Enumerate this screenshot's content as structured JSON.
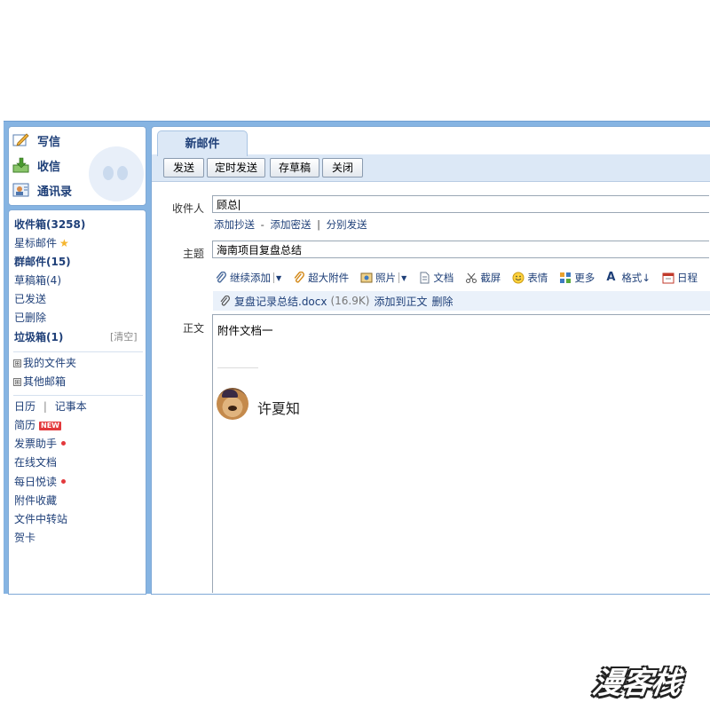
{
  "sidebar": {
    "quick": [
      {
        "label": "写信",
        "icon": "pencil-icon"
      },
      {
        "label": "收信",
        "icon": "inbox-download-icon"
      },
      {
        "label": "通讯录",
        "icon": "contacts-icon"
      }
    ],
    "folders": [
      {
        "label": "收件箱(3258)",
        "bold": true
      },
      {
        "label": "星标邮件",
        "icon": "star-icon"
      },
      {
        "label": "群邮件(15)",
        "bold": true
      },
      {
        "label": "草稿箱(4)"
      },
      {
        "label": "已发送"
      },
      {
        "label": "已删除"
      },
      {
        "label": "垃圾箱(1)",
        "bold": true,
        "action": "[清空]"
      }
    ],
    "groups": [
      {
        "label": "我的文件夹",
        "expander": "⊞"
      },
      {
        "label": "其他邮箱",
        "expander": "⊞"
      }
    ],
    "tools": {
      "calendar": "日历",
      "tool_sep": "|",
      "notebook": "记事本",
      "resume": "简历",
      "resume_badge": "NEW",
      "invoice": "发票助手",
      "online_docs": "在线文档",
      "daily_read": "每日悦读",
      "attach_fav": "附件收藏",
      "file_transfer": "文件中转站",
      "greeting_card": "贺卡"
    }
  },
  "compose": {
    "tab_label": "新邮件",
    "toolbar": {
      "send": "发送",
      "scheduled": "定时发送",
      "save_draft": "存草稿",
      "close": "关闭"
    },
    "to_label": "收件人",
    "to_value": "顾总",
    "links": {
      "add_cc": "添加抄送",
      "dash": "-",
      "add_bcc": "添加密送",
      "pipe": "|",
      "separate_send": "分别发送"
    },
    "subject_label": "主题",
    "subject_value": "海南项目复盘总结",
    "format_bar": {
      "continue_add": "继续添加",
      "big_attach": "超大附件",
      "photo": "照片",
      "document": "文档",
      "screenshot": "截屏",
      "emoji": "表情",
      "more": "更多",
      "format": "格式↓",
      "schedule": "日程"
    },
    "attachment": {
      "name": "复盘记录总结.docx",
      "size": "(16.9K)",
      "add_to_body": "添加到正文",
      "delete": "删除"
    },
    "body_label": "正文",
    "body_text": "附件文档一",
    "signature_name": "许夏知"
  },
  "watermark": "漫客栈",
  "colors": {
    "frame": "#86b4e2",
    "accent_text": "#1e3f78",
    "toolbar_bg": "#dce8f6"
  }
}
